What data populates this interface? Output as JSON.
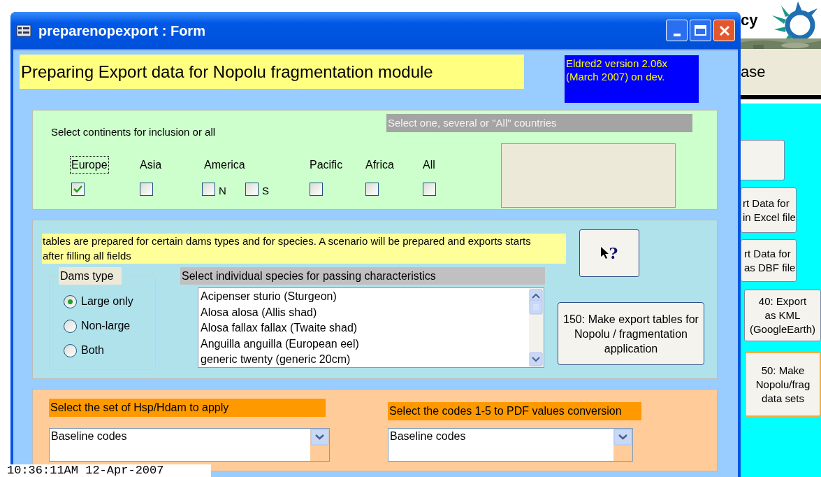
{
  "background_app": {
    "logo_text": "cy",
    "heading": "ase",
    "buttons": [
      {
        "label": "rt Data for\nin Excel file"
      },
      {
        "label": "rt Data for\nas DBF file"
      },
      {
        "label": "40: Export\nas KML\n(GoogleEarth)"
      },
      {
        "label": "50: Make\nNopolu/frag\ndata sets",
        "focused": true
      }
    ]
  },
  "window": {
    "title": "preparenopexport : Form"
  },
  "header": {
    "title": "Preparing Export data for Nopolu fragmentation module",
    "version": "Eldred2 version 2.06x\n(March 2007) on dev."
  },
  "continents": {
    "label": "Select continents for inclusion or all",
    "countries_placeholder": "Select one, several or \"All\" countries",
    "items": [
      {
        "label": "Europe",
        "checked": true,
        "focused": true
      },
      {
        "label": "Asia",
        "checked": false,
        "focused": false
      },
      {
        "label": "America",
        "focused": false,
        "parts": [
          {
            "label": "N",
            "checked": false
          },
          {
            "label": "S",
            "checked": false
          }
        ]
      },
      {
        "label": "Pacific",
        "checked": false,
        "focused": false
      },
      {
        "label": "Africa",
        "checked": false,
        "focused": false
      },
      {
        "label": "All",
        "checked": false,
        "focused": false
      }
    ]
  },
  "scenario": {
    "note": "tables are prepared for certain dams types and for species. A scenario will be prepared and exports starts after filling all fields",
    "help_button": "?",
    "dams_type": {
      "legend": "Dams type",
      "options": [
        {
          "label": "Large only",
          "selected": true
        },
        {
          "label": "Non-large",
          "selected": false
        },
        {
          "label": "Both",
          "selected": false
        }
      ]
    },
    "species": {
      "header": "Select individual species for passing characteristics",
      "items": [
        "Acipenser sturio (Sturgeon)",
        "Alosa alosa (Allis shad)",
        "Alosa fallax fallax (Twaite shad)",
        "Anguilla anguilla (European eel)",
        "generic twenty (generic 20cm)"
      ]
    },
    "make_button": "150: Make export tables for Nopolu / fragmentation application"
  },
  "codes": [
    {
      "label": "Select the set of Hsp/Hdam to apply",
      "value": "Baseline codes"
    },
    {
      "label": "Select the codes 1-5 to PDF values conversion",
      "value": "Baseline codes"
    }
  ],
  "status_time": "10:36:11AM 12-Apr-2007"
}
